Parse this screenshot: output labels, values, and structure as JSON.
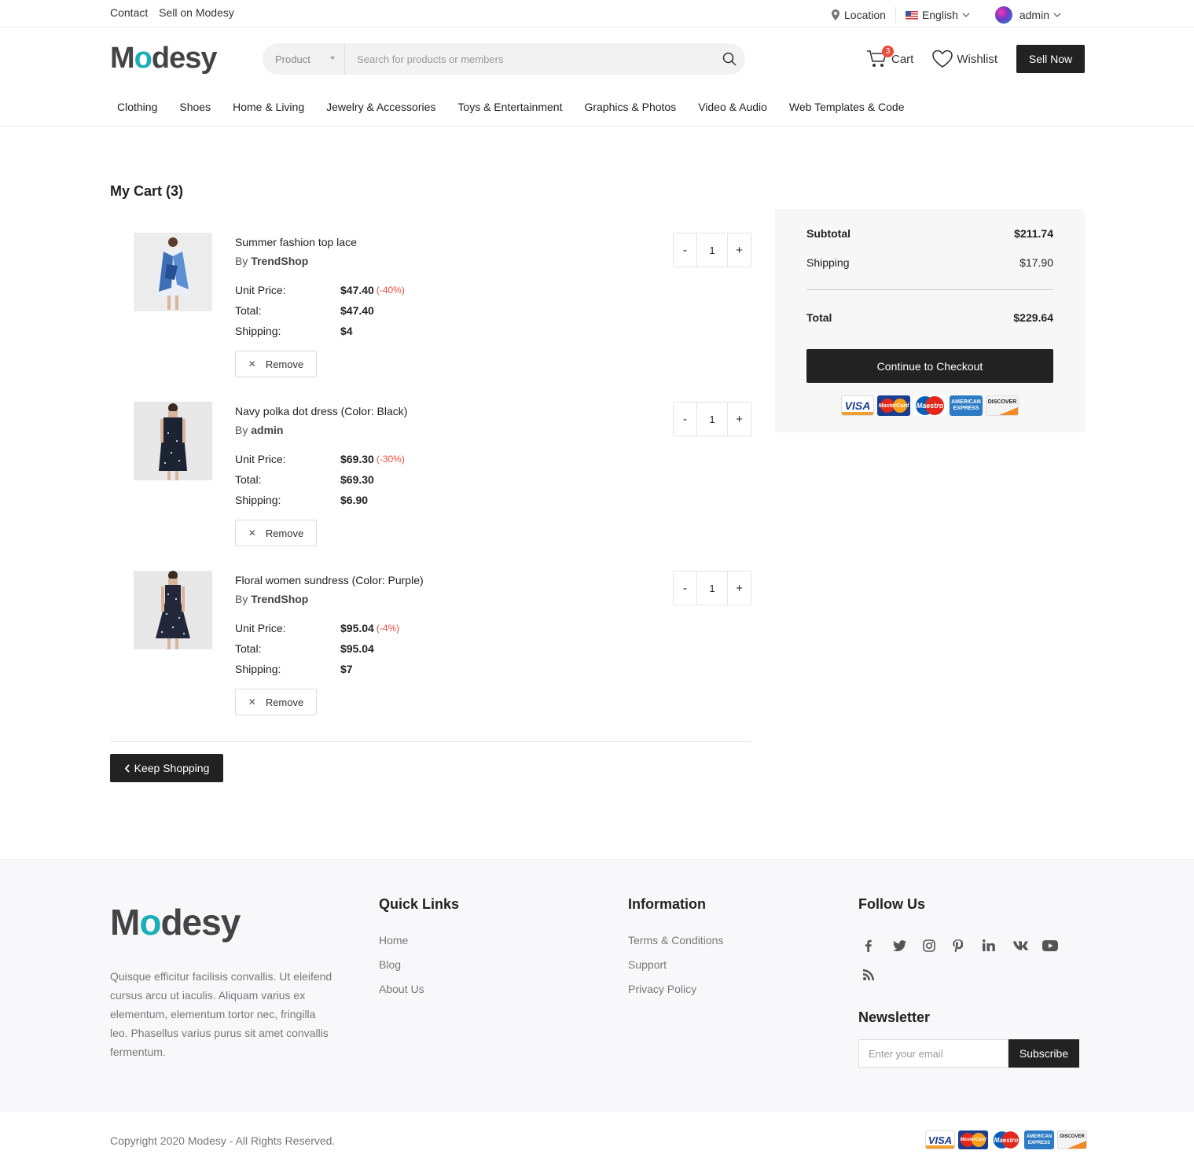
{
  "topbar": {
    "contact": "Contact",
    "sell": "Sell on Modesy",
    "location": "Location",
    "language": "English",
    "user": "admin"
  },
  "header": {
    "logo_pre": "M",
    "logo_o": "o",
    "logo_post": "desy",
    "search_category": "Product",
    "search_placeholder": "Search for products or members",
    "cart_label": "Cart",
    "cart_count": "3",
    "wishlist_label": "Wishlist",
    "sell_now": "Sell Now"
  },
  "nav": [
    "Clothing",
    "Shoes",
    "Home & Living",
    "Jewelry & Accessories",
    "Toys & Entertainment",
    "Graphics & Photos",
    "Video & Audio",
    "Web Templates & Code"
  ],
  "cart": {
    "title": "My Cart (3)",
    "labels": {
      "unit": "Unit Price:",
      "total": "Total:",
      "shipping": "Shipping:",
      "by": "By",
      "remove": "Remove"
    },
    "items": [
      {
        "name": "Summer fashion top lace",
        "seller": "TrendShop",
        "unit_price": "$47.40",
        "discount": "(-40%)",
        "total": "$47.40",
        "shipping": "$4",
        "qty": "1"
      },
      {
        "name": "Navy polka dot dress (Color: Black)",
        "seller": "admin",
        "unit_price": "$69.30",
        "discount": "(-30%)",
        "total": "$69.30",
        "shipping": "$6.90",
        "qty": "1"
      },
      {
        "name": "Floral women sundress (Color: Purple)",
        "seller": "TrendShop",
        "unit_price": "$95.04",
        "discount": "(-4%)",
        "total": "$95.04",
        "shipping": "$7",
        "qty": "1"
      }
    ],
    "minus": "-",
    "plus": "+",
    "keep_shopping": "Keep Shopping"
  },
  "summary": {
    "subtotal_label": "Subtotal",
    "subtotal": "$211.74",
    "shipping_label": "Shipping",
    "shipping": "$17.90",
    "total_label": "Total",
    "total": "$229.64",
    "checkout": "Continue to Checkout"
  },
  "payment_cards": {
    "visa": "VISA",
    "mastercard": "MasterCard",
    "maestro": "Maestro",
    "amex": "AMERICAN EXPRESS",
    "discover": "DISCOVER"
  },
  "footer": {
    "description": "Quisque efficitur facilisis convallis. Ut eleifend cursus arcu ut iaculis. Aliquam varius ex elementum, elementum tortor nec, fringilla leo. Phasellus varius purus sit amet convallis fermentum.",
    "quick_links_title": "Quick Links",
    "quick_links": [
      "Home",
      "Blog",
      "About Us"
    ],
    "info_title": "Information",
    "info_links": [
      "Terms & Conditions",
      "Support",
      "Privacy Policy"
    ],
    "follow_title": "Follow Us",
    "social": [
      "facebook-icon",
      "twitter-icon",
      "instagram-icon",
      "pinterest-icon",
      "linkedin-icon",
      "vk-icon",
      "youtube-icon",
      "rss-icon"
    ],
    "newsletter_title": "Newsletter",
    "email_placeholder": "Enter your email",
    "subscribe": "Subscribe",
    "copyright": "Copyright 2020 Modesy - All Rights Reserved."
  }
}
